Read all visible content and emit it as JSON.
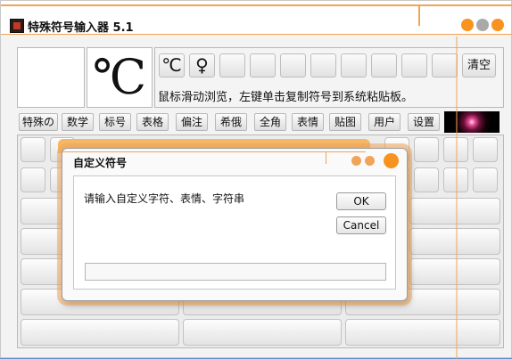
{
  "window": {
    "title": "特殊符号输入器 5.1"
  },
  "preview": {
    "symbol": "℃"
  },
  "recent_symbols": [
    "℃",
    "♀",
    "",
    "",
    "",
    "",
    "",
    "",
    "",
    "",
    ""
  ],
  "clear_label": "清空",
  "hint": "鼠标滑动浏览，左键单击复制符号到系统粘贴板。",
  "tabs": [
    "特殊の",
    "数学",
    "标号",
    "表格",
    "偏注",
    "希俄",
    "全角",
    "表情",
    "贴图",
    "用户",
    "设置"
  ],
  "dialog": {
    "title": "自定义符号",
    "prompt": "请输入自定义字符、表情、字符串",
    "ok_label": "OK",
    "cancel_label": "Cancel",
    "input_value": ""
  },
  "colors": {
    "accent_orange": "#f7931e",
    "frame_line": "#f0a458"
  }
}
